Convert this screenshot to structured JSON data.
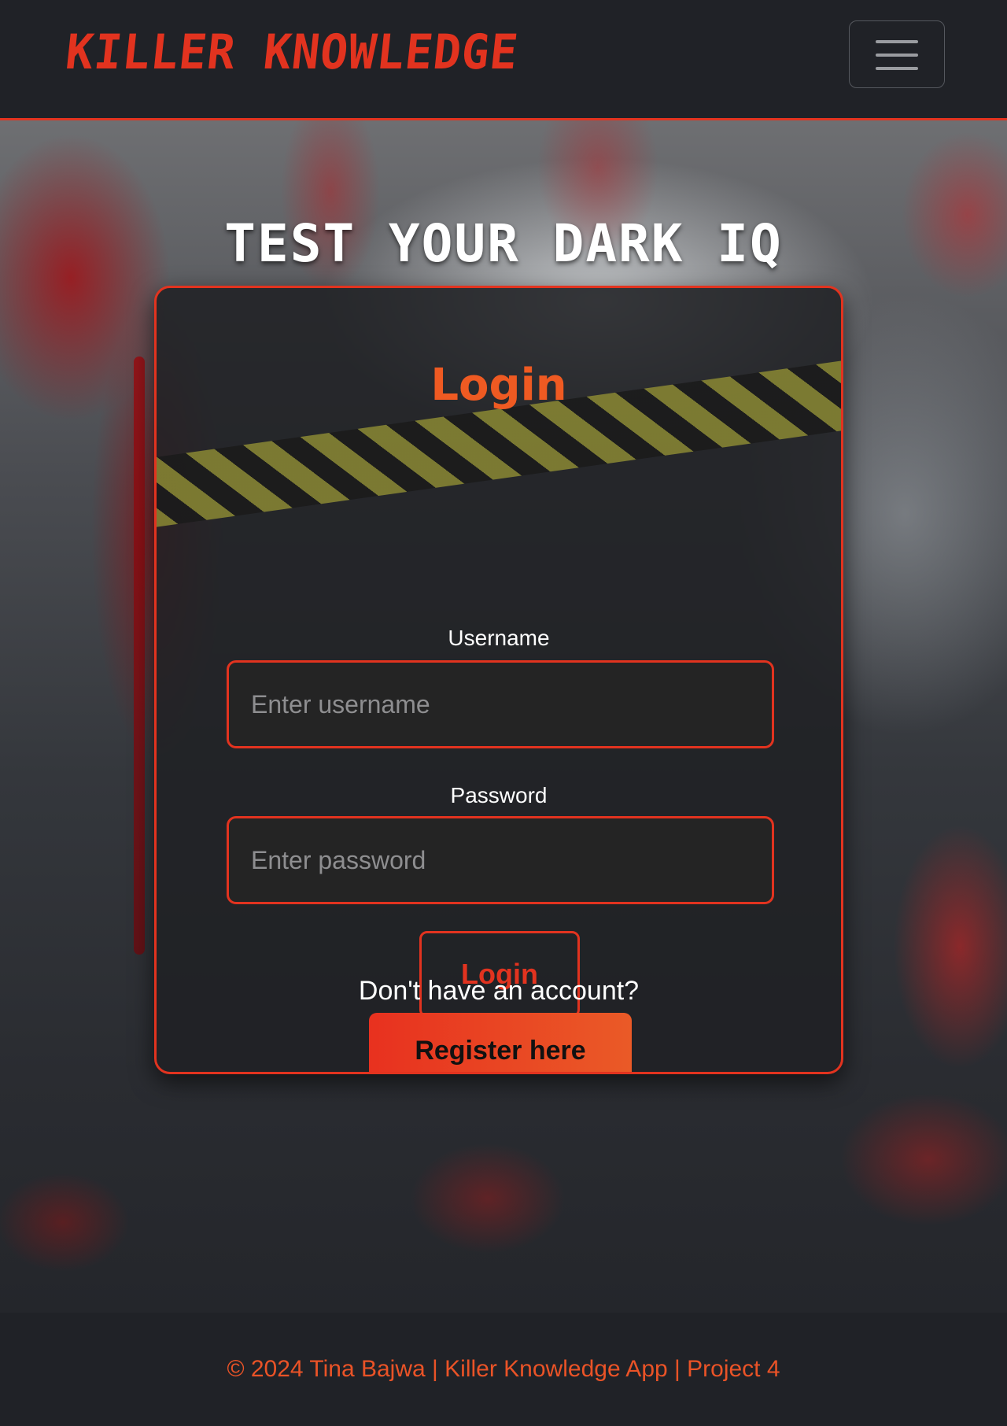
{
  "navbar": {
    "brand": "KILLER KNOWLEDGE",
    "menu_icon": "hamburger-menu-icon"
  },
  "hero": {
    "title": "TEST YOUR DARK IQ"
  },
  "login_card": {
    "title": "Login",
    "username_label": "Username",
    "username_placeholder": "Enter username",
    "password_label": "Password",
    "password_placeholder": "Enter password",
    "login_button": "Login",
    "no_account_text": "Don't have an account?",
    "register_button": "Register here"
  },
  "footer": {
    "text": "© 2024 Tina Bajwa | Killer Knowledge App | Project 4"
  },
  "colors": {
    "accent": "#e2331f",
    "navbar_bg": "#202227",
    "card_bg": "#242424"
  }
}
